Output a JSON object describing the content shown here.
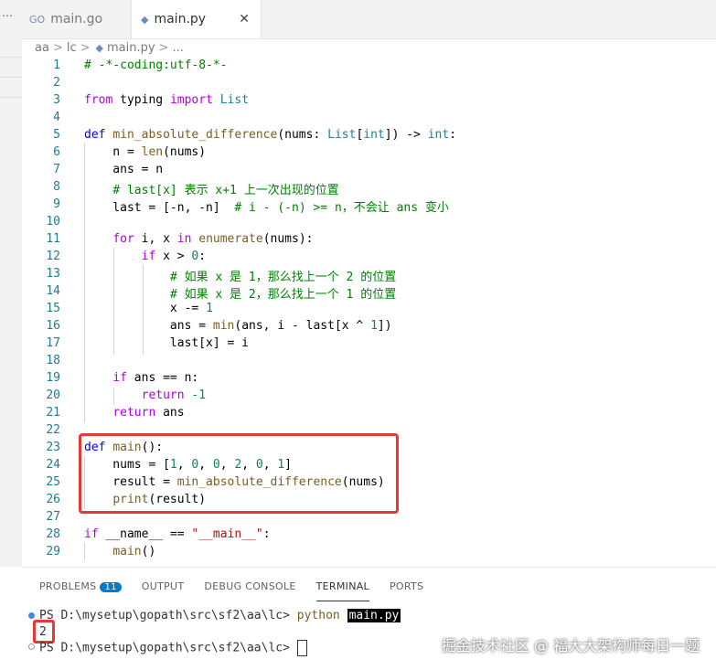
{
  "tabs": [
    {
      "icon": "go-file-icon",
      "label": "main.go",
      "glyph": "GO"
    },
    {
      "icon": "python-file-icon",
      "label": "main.py",
      "close": "✕"
    }
  ],
  "breadcrumb": [
    "aa",
    "lc",
    "main.py",
    "..."
  ],
  "code": {
    "line_numbers": [
      "1",
      "2",
      "3",
      "4",
      "5",
      "6",
      "7",
      "8",
      "9",
      "10",
      "11",
      "12",
      "13",
      "14",
      "15",
      "16",
      "17",
      "18",
      "19",
      "20",
      "21",
      "22",
      "23",
      "24",
      "25",
      "26",
      "27",
      "28",
      "29"
    ],
    "lines": [
      "# -*-coding:utf-8-*-",
      "",
      "from typing import List",
      "",
      "def min_absolute_difference(nums: List[int]) -> int:",
      "    n = len(nums)",
      "    ans = n",
      "    # last[x] 表示 x+1 上一次出现的位置",
      "    last = [-n, -n]  # i - (-n) >= n，不会让 ans 变小",
      "",
      "    for i, x in enumerate(nums):",
      "        if x > 0:",
      "            # 如果 x 是 1，那么找上一个 2 的位置",
      "            # 如果 x 是 2，那么找上一个 1 的位置",
      "            x -= 1",
      "            ans = min(ans, i - last[x ^ 1])",
      "            last[x] = i",
      "",
      "    if ans == n:",
      "        return -1",
      "    return ans",
      "",
      "def main():",
      "    nums = [1, 0, 0, 2, 0, 1]",
      "    result = min_absolute_difference(nums)",
      "    print(result)",
      "",
      "if __name__ == \"__main__\":",
      "    main()"
    ]
  },
  "panel": {
    "tabs": [
      "PROBLEMS",
      "OUTPUT",
      "DEBUG CONSOLE",
      "TERMINAL",
      "PORTS"
    ],
    "problems_count": "11",
    "active_tab": "TERMINAL"
  },
  "terminal": {
    "prompt": "PS D:\\mysetup\\gopath\\src\\sf2\\aa\\lc> ",
    "command": "python",
    "arg": "main.py",
    "output": "2",
    "prompt2": "PS D:\\mysetup\\gopath\\src\\sf2\\aa\\lc> "
  },
  "watermark": "掘金技术社区 @ 福大大架构师每日一题",
  "colors": {
    "accent": "#007acc",
    "highlight_box": "#e53935"
  }
}
